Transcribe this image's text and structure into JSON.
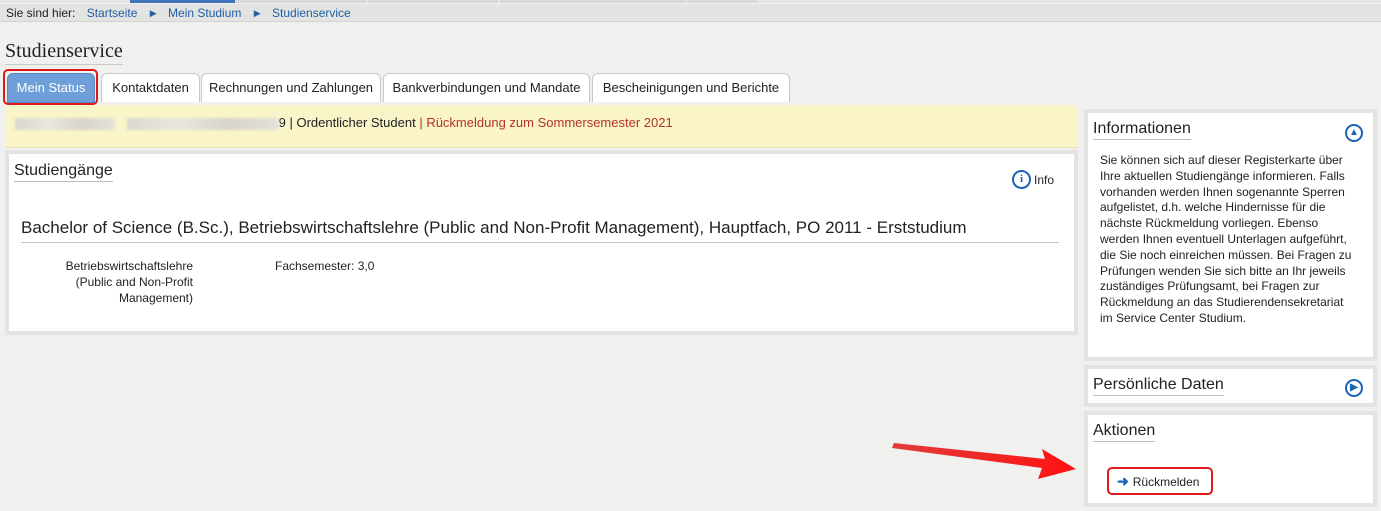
{
  "breadcrumb": {
    "label": "Sie sind hier:",
    "items": [
      "Startseite",
      "Mein Studium",
      "Studienservice"
    ]
  },
  "page_title": "Studienservice",
  "tabs": [
    {
      "label": "Mein Status",
      "active": true
    },
    {
      "label": "Kontaktdaten",
      "active": false
    },
    {
      "label": "Rechnungen und Zahlungen",
      "active": false
    },
    {
      "label": "Bankverbindungen und Mandate",
      "active": false
    },
    {
      "label": "Bescheinigungen und Berichte",
      "active": false
    }
  ],
  "status_bar": {
    "id_suffix": "9",
    "separator": " | ",
    "student_type": "Ordentlicher Student",
    "reregistration": "| Rückmeldung zum Sommersemester 2021"
  },
  "studies": {
    "title": "Studiengänge",
    "info_label": "Info",
    "degree": "Bachelor of Science (B.Sc.), Betriebswirtschaftslehre (Public and Non-Profit Management), Hauptfach, PO 2011 - Erststudium",
    "subject": "Betriebswirtschaftslehre (Public and Non-Profit Management)",
    "semester": "Fachsemester: 3,0"
  },
  "sidebar": {
    "informationen": {
      "title": "Informationen",
      "text": "Sie können sich auf dieser Registerkarte über Ihre aktuellen Studiengänge informieren. Falls vorhanden werden Ihnen sogenannte Sperren aufgelistet, d.h. welche Hindernisse für die nächste Rückmeldung vorliegen. Ebenso werden Ihnen eventuell Unterlagen aufgeführt, die Sie noch einreichen müssen. Bei Fragen zu Prüfungen wenden Sie sich bitte an Ihr jeweils zuständiges Prüfungsamt, bei Fragen zur Rückmeldung an das Studierendensekretariat im Service Center Studium."
    },
    "persoenliche_daten": {
      "title": "Persönliche Daten"
    },
    "aktionen": {
      "title": "Aktionen",
      "button_label": "Rückmelden"
    }
  },
  "colors": {
    "tab_active": "#6e9fd9",
    "link": "#1f5fa8",
    "status_bg": "#f9f5c9",
    "reregistration_text": "#b3322f",
    "highlight_red": "#e01a1a",
    "icon_blue": "#1a63b5"
  },
  "icons": {
    "breadcrumb_separator": "triangle-right-icon",
    "info": "info-circle-icon",
    "collapse": "chevron-up-circle-icon",
    "expand": "chevron-right-circle-icon",
    "action": "arrow-right-icon",
    "annotation": "red-arrow-annotation"
  }
}
